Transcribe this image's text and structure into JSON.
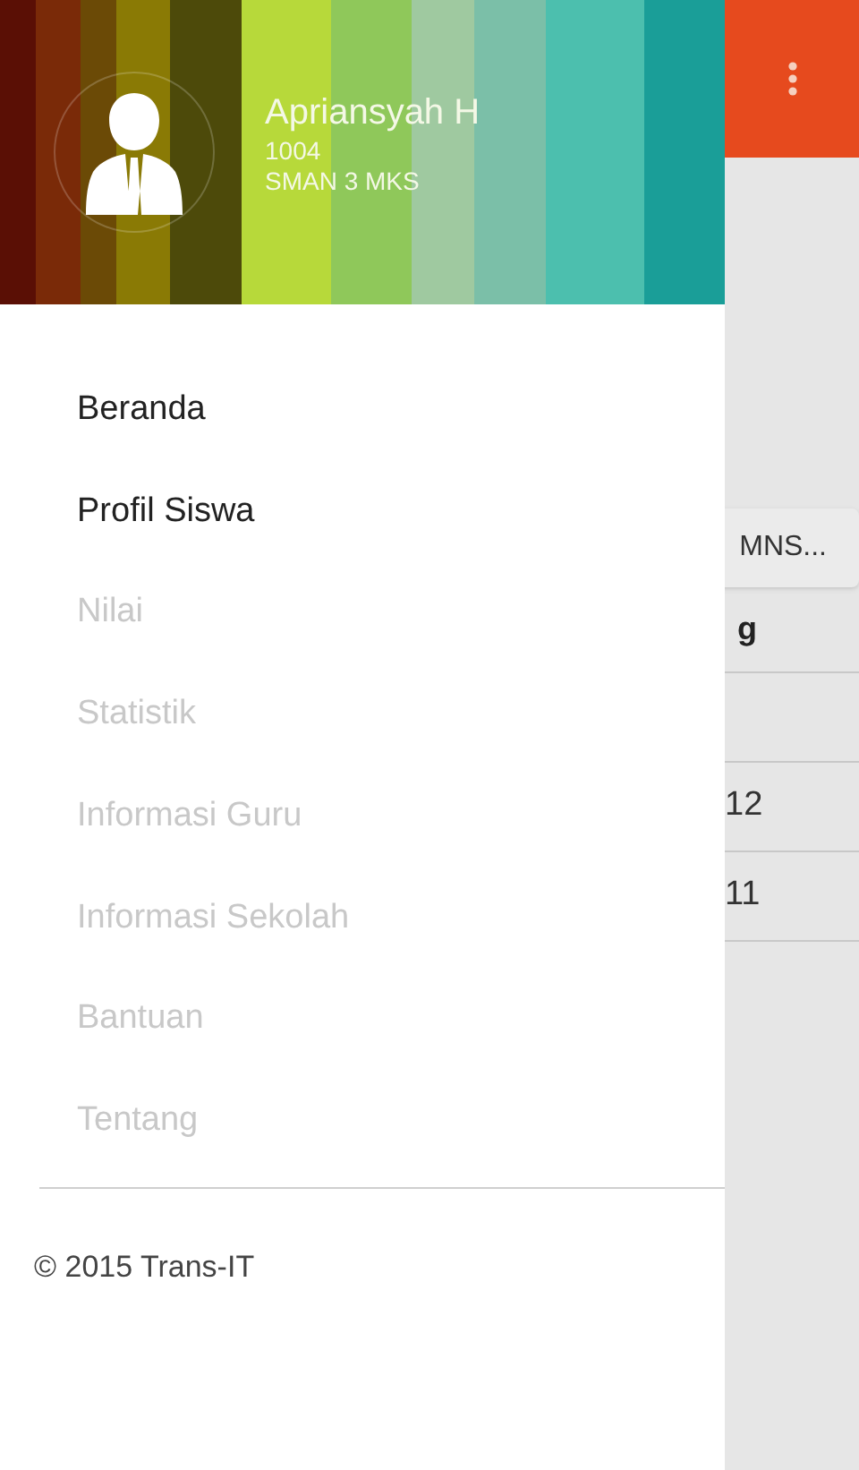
{
  "drawer": {
    "profile": {
      "name": "Apriansyah H",
      "id": "1004",
      "school": "SMAN 3 MKS"
    },
    "menu": [
      {
        "label": "Beranda",
        "disabled": false
      },
      {
        "label": "Profil Siswa",
        "disabled": false
      },
      {
        "label": "Nilai",
        "disabled": true
      },
      {
        "label": "Statistik",
        "disabled": true
      },
      {
        "label": "Informasi Guru",
        "disabled": true
      },
      {
        "label": "Informasi Sekolah",
        "disabled": true
      },
      {
        "label": "Bantuan",
        "disabled": true
      },
      {
        "label": "Tentang",
        "disabled": true
      }
    ],
    "footer": "© 2015 Trans-IT"
  },
  "background": {
    "button": "MNS...",
    "table_header": "g",
    "rows": [
      "",
      "12",
      "11"
    ]
  }
}
